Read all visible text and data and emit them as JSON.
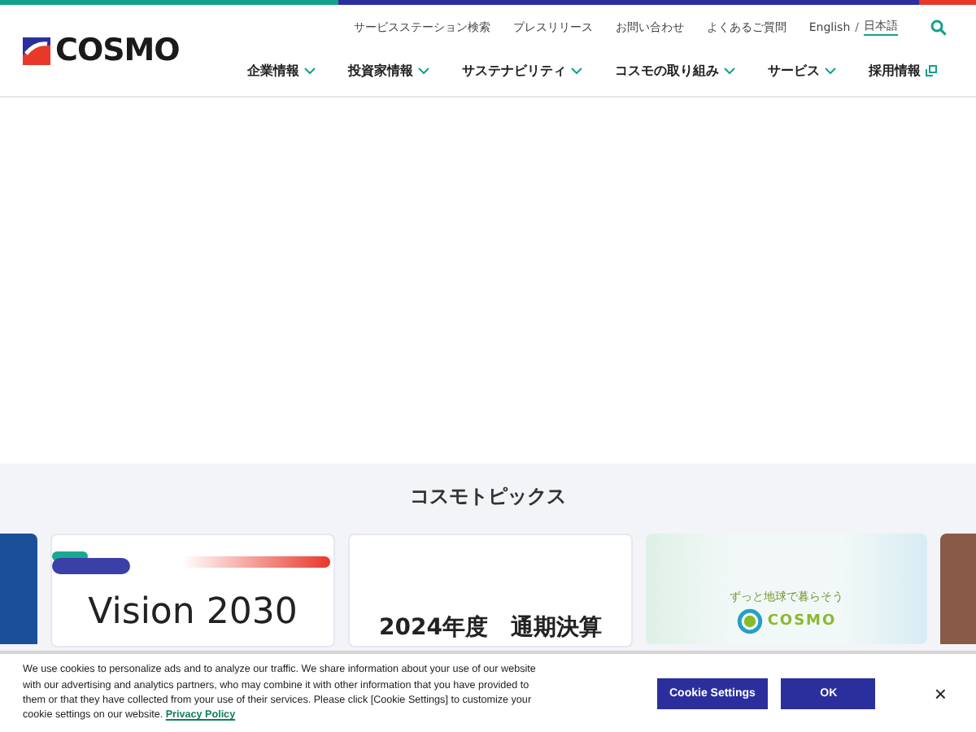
{
  "header": {
    "logo": "COSMO",
    "utility_links": [
      "サービスステーション検索",
      "プレスリリース",
      "お問い合わせ",
      "よくあるご質問"
    ],
    "languages": [
      {
        "label": "English",
        "selected": false
      },
      {
        "label": "日本語",
        "selected": true
      }
    ],
    "language_separator": "/",
    "nav": [
      {
        "label": "企業情報",
        "kind": "dropdown"
      },
      {
        "label": "投資家情報",
        "kind": "dropdown"
      },
      {
        "label": "サステナビリティ",
        "kind": "dropdown"
      },
      {
        "label": "コスモの取り組み",
        "kind": "dropdown"
      },
      {
        "label": "サービス",
        "kind": "dropdown"
      },
      {
        "label": "採用情報",
        "kind": "external"
      }
    ]
  },
  "topics": {
    "title": "コスモトピックス",
    "cards": [
      {
        "kind": "photo"
      },
      {
        "kind": "vision",
        "text": "Vision 2030"
      },
      {
        "kind": "results",
        "text": "2024年度　通期決算"
      },
      {
        "kind": "eco",
        "tagline": "ずっと地球で暮らそう",
        "brand": "COSMO"
      },
      {
        "kind": "photo"
      }
    ]
  },
  "cookie_banner": {
    "text": "We use cookies to personalize ads and to analyze our traffic. We share information about your use of our website with our advertising and analytics partners, who may combine it with other information that you have provided to them or that they have collected from your use of their services. Please click [Cookie Settings] to customize your cookie settings on our website.",
    "link": "Privacy Policy",
    "buttons": [
      "Cookie Settings",
      "OK"
    ],
    "close": "×"
  }
}
